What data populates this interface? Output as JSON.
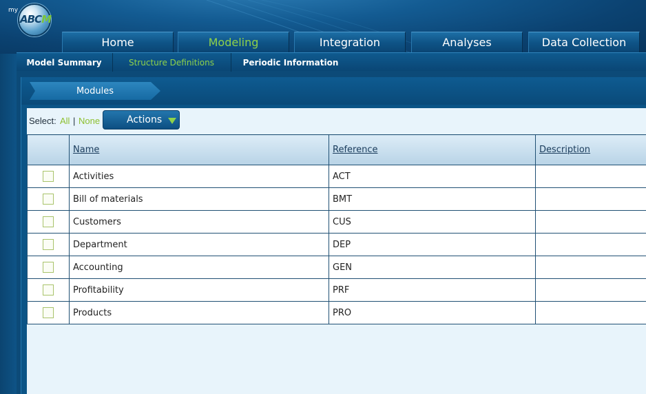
{
  "logo": {
    "small_text": "my",
    "abc": "ABC",
    "m": "M"
  },
  "main_tabs": [
    {
      "label": "Home",
      "active": false
    },
    {
      "label": "Modeling",
      "active": true
    },
    {
      "label": "Integration",
      "active": false
    },
    {
      "label": "Analyses",
      "active": false
    },
    {
      "label": "Data Collection",
      "active": false
    }
  ],
  "sub_nav": [
    {
      "label": "Model Summary",
      "active": false
    },
    {
      "label": "Structure Definitions",
      "active": true
    },
    {
      "label": "Periodic Information",
      "active": false
    }
  ],
  "breadcrumb": {
    "label": "Modules"
  },
  "select": {
    "label": "Select:",
    "all": "All",
    "separator": "|",
    "none": "None"
  },
  "actions": {
    "label": "Actions"
  },
  "table": {
    "columns": [
      "",
      "Name",
      "Reference",
      "Description"
    ],
    "rows": [
      {
        "name": "Activities",
        "reference": "ACT",
        "description": ""
      },
      {
        "name": "Bill of materials",
        "reference": "BMT",
        "description": ""
      },
      {
        "name": "Customers",
        "reference": "CUS",
        "description": ""
      },
      {
        "name": "Department",
        "reference": "DEP",
        "description": ""
      },
      {
        "name": "Accounting",
        "reference": "GEN",
        "description": ""
      },
      {
        "name": "Profitability",
        "reference": "PRF",
        "description": ""
      },
      {
        "name": "Products",
        "reference": "PRO",
        "description": ""
      }
    ]
  },
  "colors": {
    "active_green": "#8fd24a",
    "link_green": "#8dbf2e",
    "nav_blue": "#0f5487",
    "content_bg": "#e8f4fb"
  }
}
